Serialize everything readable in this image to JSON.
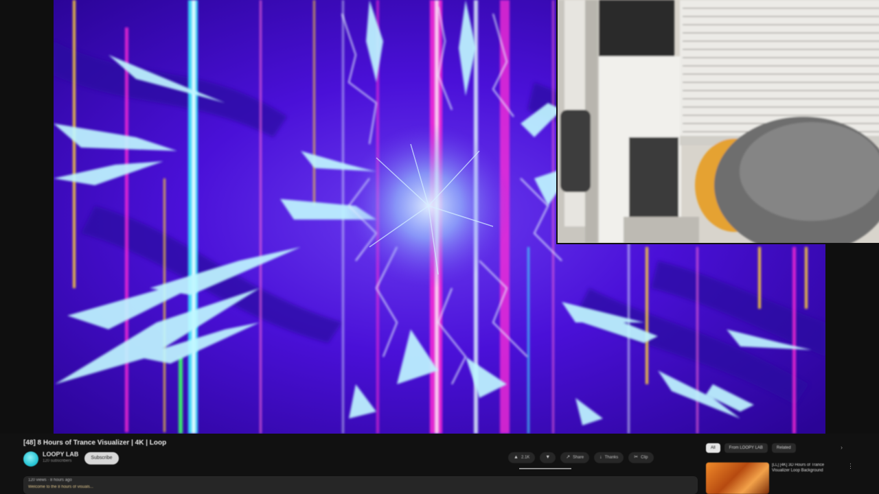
{
  "video": {
    "title": "[48] 8 Hours of Trance Visualizer | 4K | Loop",
    "channel_name": "LOOPY LAB",
    "channel_subscribers": "120 subscribers",
    "subscribe_label": "Subscribe"
  },
  "actions": [
    {
      "icon": "thumbs-up-icon",
      "glyph": "▲",
      "label": "2.1K"
    },
    {
      "icon": "thumbs-down-icon",
      "glyph": "▼",
      "label": ""
    },
    {
      "icon": "share-icon",
      "glyph": "↗",
      "label": "Share"
    },
    {
      "icon": "download-icon",
      "glyph": "↓",
      "label": "Thanks"
    },
    {
      "icon": "clip-icon",
      "glyph": "✂",
      "label": "Clip"
    }
  ],
  "description": {
    "meta": "120 views · 8 hours ago",
    "text": "Welcome to the 8 hours of visuals..."
  },
  "recommendations": {
    "chips": [
      "All",
      "From LOOPY LAB",
      "Related"
    ],
    "items": [
      {
        "title": "[LL] [4K] 3D Hours of Trance Visualizer Loop Background"
      }
    ]
  },
  "colors": {
    "background": "#0f0f0f",
    "video_base": "#3a06c8",
    "magenta": "#ff2bd6",
    "cyan": "#3ff0ff",
    "avatar": "#2ac7d7"
  }
}
